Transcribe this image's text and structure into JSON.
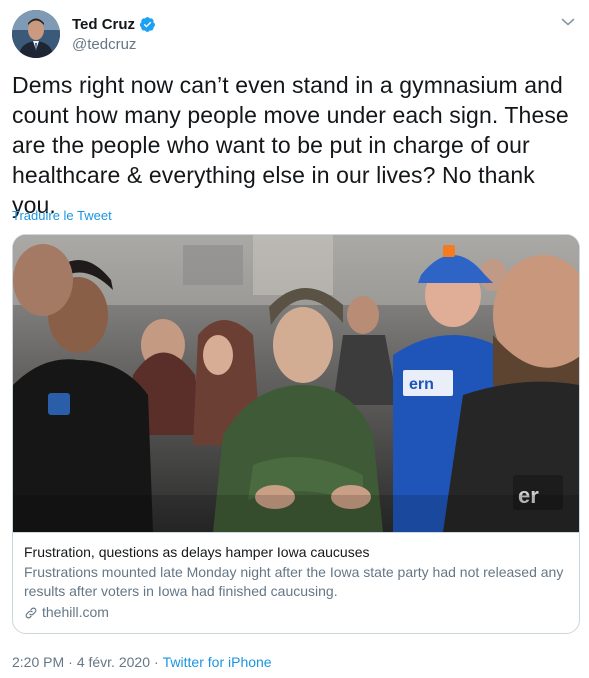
{
  "author": {
    "display_name": "Ted Cruz",
    "handle": "@tedcruz",
    "verified": true,
    "verified_color": "#1da1f2"
  },
  "tweet": {
    "text": "Dems right now can’t even stand in a gymnasium and count how many people move under each sign. These are the people who want to be put in charge of our healthcare & everything else in our lives? No thank you.",
    "translate_label": "Traduire le Tweet"
  },
  "card": {
    "title": "Frustration, questions as delays hamper Iowa caucuses",
    "description": "Frustrations mounted late Monday night after the Iowa state party had not released any results after voters in Iowa had finished caucusing.",
    "domain": "thehill.com"
  },
  "meta": {
    "time": "2:20 PM",
    "separator1": "·",
    "date": "4 févr. 2020",
    "separator2": "·",
    "source": "Twitter for iPhone"
  },
  "colors": {
    "link": "#1b95e0",
    "secondary_text": "#657786",
    "border": "#ccd6dd"
  },
  "icons": {
    "verified": "verified-badge-icon",
    "caret": "chevron-down-icon",
    "link": "link-icon"
  }
}
